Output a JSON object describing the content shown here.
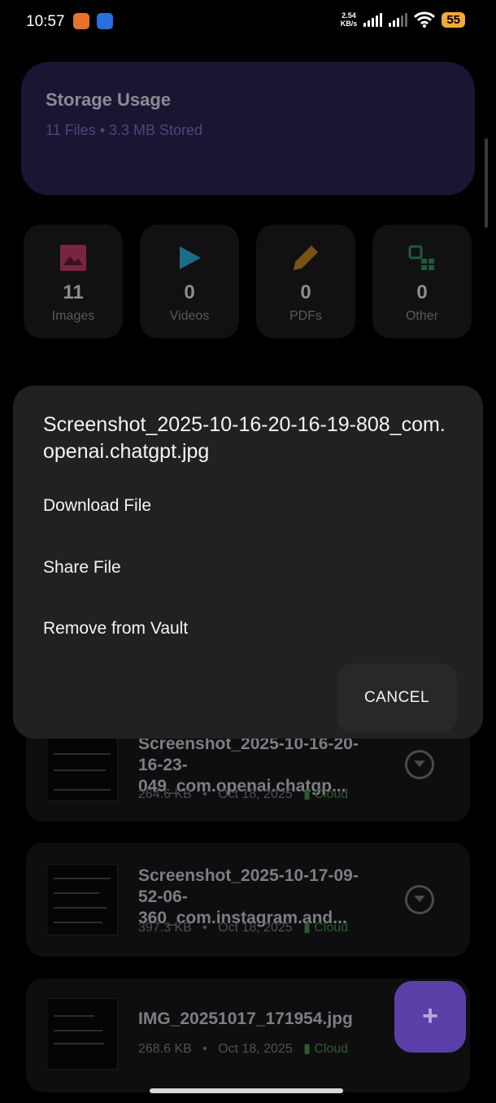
{
  "status_bar": {
    "time": "10:57",
    "app_icons": [
      "temu-icon",
      "phone-app-icon"
    ],
    "net_speed_value": "2.54",
    "net_speed_unit": "KB/s",
    "battery": "55"
  },
  "storage": {
    "title": "Storage Usage",
    "subtitle": "11 Files • 3.3 MB Stored"
  },
  "categories": [
    {
      "icon": "image-icon",
      "count": "11",
      "label": "Images",
      "color": "#7a2540"
    },
    {
      "icon": "play-icon",
      "count": "0",
      "label": "Videos",
      "color": "#1a6f86"
    },
    {
      "icon": "pencil-icon",
      "count": "0",
      "label": "PDFs",
      "color": "#7a5214"
    },
    {
      "icon": "other-files-icon",
      "count": "0",
      "label": "Other",
      "color": "#1e5a3c"
    }
  ],
  "files": [
    {
      "name": "Screenshot_2025-10-16-20-16-23-049_com.openai.chatgp...",
      "size": "264.6 KB",
      "date": "Oct 18, 2025",
      "location": "Cloud"
    },
    {
      "name": "Screenshot_2025-10-17-09-52-06-360_com.instagram.and...",
      "size": "397.3 KB",
      "date": "Oct 18, 2025",
      "location": "Cloud"
    },
    {
      "name": "IMG_20251017_171954.jpg",
      "size": "268.6 KB",
      "date": "Oct 18, 2025",
      "location": "Cloud"
    }
  ],
  "meta_separator": "•",
  "fab_label": "+",
  "dialog": {
    "title": "Screenshot_2025-10-16-20-16-19-808_com.openai.chatgpt.jpg",
    "items": [
      "Download File",
      "Share File",
      "Remove from Vault"
    ],
    "cancel": "CANCEL"
  },
  "colors": {
    "accent": "#5b3fa8",
    "dialog_bg": "#212124",
    "cloud": "#2d5a30"
  }
}
